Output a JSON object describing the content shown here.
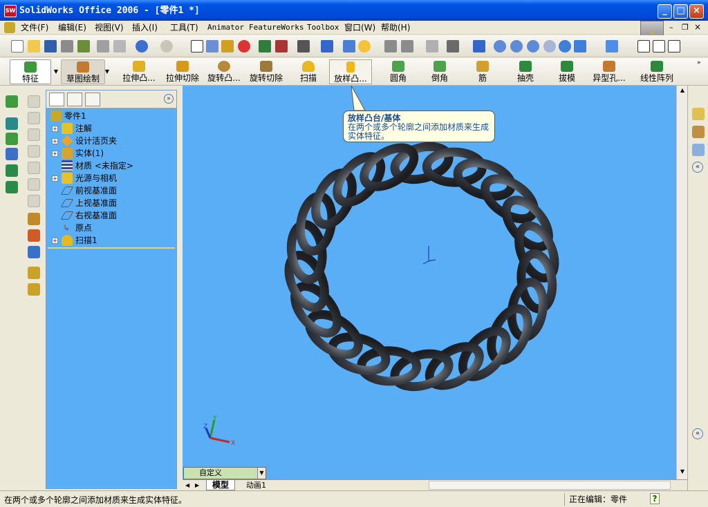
{
  "window": {
    "title": "SolidWorks Office 2006 - [零件1 *]",
    "icon": "SW"
  },
  "menu": [
    "文件(F)",
    "编辑(E)",
    "视图(V)",
    "插入(I)",
    "工具(T)",
    "Animator",
    "FeatureWorks",
    "Toolbox",
    "窗口(W)",
    "帮助(H)"
  ],
  "command_manager": {
    "tab_feature": "特征",
    "tab_sketch": "草图绘制",
    "buttons": [
      "拉伸凸...",
      "拉伸切除",
      "旋转凸...",
      "旋转切除",
      "扫描",
      "放样凸...",
      "圆角",
      "倒角",
      "筋",
      "抽壳",
      "拔模",
      "异型孔...",
      "线性阵列"
    ]
  },
  "tooltip": {
    "title": "放样凸台/基体",
    "body": "在两个或多个轮廓之间添加材质来生成实体特征。"
  },
  "tree": {
    "root": "零件1",
    "items": [
      "注解",
      "设计活页夹",
      "实体(1)",
      "材质 <未指定>",
      "光源与相机",
      "前视基准面",
      "上视基准面",
      "右视基准面",
      "原点",
      "扫描1"
    ]
  },
  "view": {
    "scheme_select": "自定义",
    "tabs": [
      "模型",
      "动画1"
    ]
  },
  "status": {
    "message": "在两个或多个轮廓之间添加材质来生成实体特征。",
    "mode": "正在编辑：零件",
    "help": "?"
  },
  "colors": {
    "viewport": "#5aaef6",
    "model": "#3b3f46",
    "titlebar": "#0054e3"
  }
}
